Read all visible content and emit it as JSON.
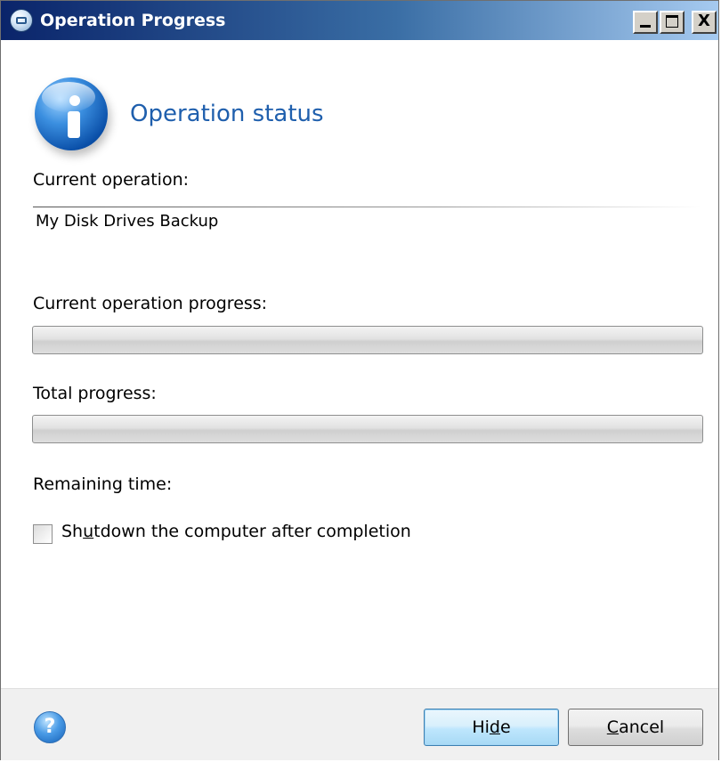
{
  "window": {
    "title": "Operation Progress",
    "controls": {
      "minimize": "_",
      "maximize": "□",
      "close": "X"
    }
  },
  "header": {
    "icon": "info-icon",
    "heading": "Operation status"
  },
  "current_operation": {
    "label": "Current operation:",
    "value": "My Disk Drives Backup"
  },
  "current_progress": {
    "label": "Current operation progress:",
    "percent": 0
  },
  "total_progress": {
    "label": "Total progress:",
    "percent": 0
  },
  "remaining_time": {
    "label": "Remaining time:"
  },
  "shutdown_option": {
    "label_before": "Sh",
    "label_accel": "u",
    "label_after": "tdown the computer after completion",
    "checked": false
  },
  "footer": {
    "help_icon": "help-icon",
    "help_glyph": "?",
    "hide_button": {
      "before": "Hi",
      "accel": "d",
      "after": "e"
    },
    "cancel_button": {
      "before": "",
      "accel": "C",
      "after": "ancel"
    }
  },
  "colors": {
    "title_bar_start": "#0a246a",
    "title_bar_end": "#a6caf0",
    "heading": "#1f5fad",
    "default_button_border": "#3c7fb1"
  }
}
